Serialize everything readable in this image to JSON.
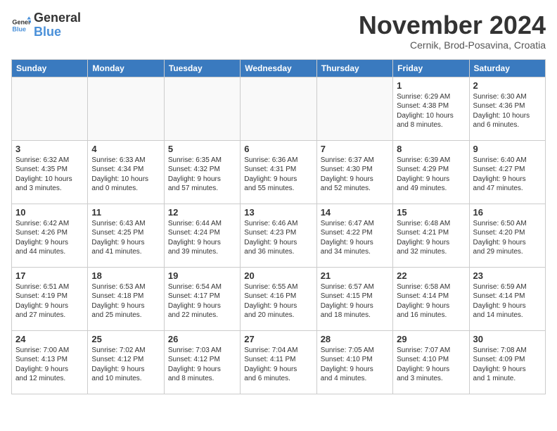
{
  "header": {
    "logo_general": "General",
    "logo_blue": "Blue",
    "month_title": "November 2024",
    "location": "Cernik, Brod-Posavina, Croatia"
  },
  "days_of_week": [
    "Sunday",
    "Monday",
    "Tuesday",
    "Wednesday",
    "Thursday",
    "Friday",
    "Saturday"
  ],
  "weeks": [
    [
      {
        "day": "",
        "info": ""
      },
      {
        "day": "",
        "info": ""
      },
      {
        "day": "",
        "info": ""
      },
      {
        "day": "",
        "info": ""
      },
      {
        "day": "",
        "info": ""
      },
      {
        "day": "1",
        "info": "Sunrise: 6:29 AM\nSunset: 4:38 PM\nDaylight: 10 hours\nand 8 minutes."
      },
      {
        "day": "2",
        "info": "Sunrise: 6:30 AM\nSunset: 4:36 PM\nDaylight: 10 hours\nand 6 minutes."
      }
    ],
    [
      {
        "day": "3",
        "info": "Sunrise: 6:32 AM\nSunset: 4:35 PM\nDaylight: 10 hours\nand 3 minutes."
      },
      {
        "day": "4",
        "info": "Sunrise: 6:33 AM\nSunset: 4:34 PM\nDaylight: 10 hours\nand 0 minutes."
      },
      {
        "day": "5",
        "info": "Sunrise: 6:35 AM\nSunset: 4:32 PM\nDaylight: 9 hours\nand 57 minutes."
      },
      {
        "day": "6",
        "info": "Sunrise: 6:36 AM\nSunset: 4:31 PM\nDaylight: 9 hours\nand 55 minutes."
      },
      {
        "day": "7",
        "info": "Sunrise: 6:37 AM\nSunset: 4:30 PM\nDaylight: 9 hours\nand 52 minutes."
      },
      {
        "day": "8",
        "info": "Sunrise: 6:39 AM\nSunset: 4:29 PM\nDaylight: 9 hours\nand 49 minutes."
      },
      {
        "day": "9",
        "info": "Sunrise: 6:40 AM\nSunset: 4:27 PM\nDaylight: 9 hours\nand 47 minutes."
      }
    ],
    [
      {
        "day": "10",
        "info": "Sunrise: 6:42 AM\nSunset: 4:26 PM\nDaylight: 9 hours\nand 44 minutes."
      },
      {
        "day": "11",
        "info": "Sunrise: 6:43 AM\nSunset: 4:25 PM\nDaylight: 9 hours\nand 41 minutes."
      },
      {
        "day": "12",
        "info": "Sunrise: 6:44 AM\nSunset: 4:24 PM\nDaylight: 9 hours\nand 39 minutes."
      },
      {
        "day": "13",
        "info": "Sunrise: 6:46 AM\nSunset: 4:23 PM\nDaylight: 9 hours\nand 36 minutes."
      },
      {
        "day": "14",
        "info": "Sunrise: 6:47 AM\nSunset: 4:22 PM\nDaylight: 9 hours\nand 34 minutes."
      },
      {
        "day": "15",
        "info": "Sunrise: 6:48 AM\nSunset: 4:21 PM\nDaylight: 9 hours\nand 32 minutes."
      },
      {
        "day": "16",
        "info": "Sunrise: 6:50 AM\nSunset: 4:20 PM\nDaylight: 9 hours\nand 29 minutes."
      }
    ],
    [
      {
        "day": "17",
        "info": "Sunrise: 6:51 AM\nSunset: 4:19 PM\nDaylight: 9 hours\nand 27 minutes."
      },
      {
        "day": "18",
        "info": "Sunrise: 6:53 AM\nSunset: 4:18 PM\nDaylight: 9 hours\nand 25 minutes."
      },
      {
        "day": "19",
        "info": "Sunrise: 6:54 AM\nSunset: 4:17 PM\nDaylight: 9 hours\nand 22 minutes."
      },
      {
        "day": "20",
        "info": "Sunrise: 6:55 AM\nSunset: 4:16 PM\nDaylight: 9 hours\nand 20 minutes."
      },
      {
        "day": "21",
        "info": "Sunrise: 6:57 AM\nSunset: 4:15 PM\nDaylight: 9 hours\nand 18 minutes."
      },
      {
        "day": "22",
        "info": "Sunrise: 6:58 AM\nSunset: 4:14 PM\nDaylight: 9 hours\nand 16 minutes."
      },
      {
        "day": "23",
        "info": "Sunrise: 6:59 AM\nSunset: 4:14 PM\nDaylight: 9 hours\nand 14 minutes."
      }
    ],
    [
      {
        "day": "24",
        "info": "Sunrise: 7:00 AM\nSunset: 4:13 PM\nDaylight: 9 hours\nand 12 minutes."
      },
      {
        "day": "25",
        "info": "Sunrise: 7:02 AM\nSunset: 4:12 PM\nDaylight: 9 hours\nand 10 minutes."
      },
      {
        "day": "26",
        "info": "Sunrise: 7:03 AM\nSunset: 4:12 PM\nDaylight: 9 hours\nand 8 minutes."
      },
      {
        "day": "27",
        "info": "Sunrise: 7:04 AM\nSunset: 4:11 PM\nDaylight: 9 hours\nand 6 minutes."
      },
      {
        "day": "28",
        "info": "Sunrise: 7:05 AM\nSunset: 4:10 PM\nDaylight: 9 hours\nand 4 minutes."
      },
      {
        "day": "29",
        "info": "Sunrise: 7:07 AM\nSunset: 4:10 PM\nDaylight: 9 hours\nand 3 minutes."
      },
      {
        "day": "30",
        "info": "Sunrise: 7:08 AM\nSunset: 4:09 PM\nDaylight: 9 hours\nand 1 minute."
      }
    ]
  ]
}
